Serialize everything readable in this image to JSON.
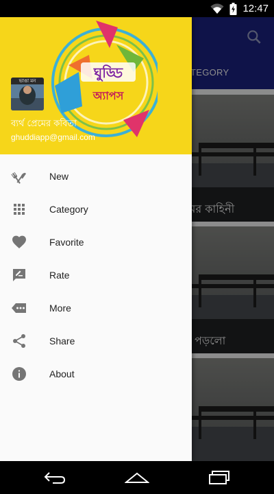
{
  "status_bar": {
    "time": "12:47"
  },
  "app_bar": {
    "tab_label": "ATEGORY"
  },
  "cards": [
    {
      "title": "মের কাহিনী"
    },
    {
      "title": "ম পড়লো"
    },
    {
      "title": ""
    }
  ],
  "drawer": {
    "logo_text_top": "ঘুড্ডি",
    "logo_text_bottom": "অ্যাপস",
    "avatar_label": "ভাঙা মন",
    "user_name": "ব্যর্থ প্রেমের কবিতা",
    "user_email": "ghuddiapp@gmail.com",
    "menu": [
      {
        "label": "New",
        "icon": "restaurant-icon"
      },
      {
        "label": "Category",
        "icon": "grid-icon"
      },
      {
        "label": "Favorite",
        "icon": "heart-icon"
      },
      {
        "label": "Rate",
        "icon": "rate-review-icon"
      },
      {
        "label": "More",
        "icon": "more-icon"
      },
      {
        "label": "Share",
        "icon": "share-icon"
      },
      {
        "label": "About",
        "icon": "info-icon"
      }
    ]
  },
  "colors": {
    "app_bar": "#1d2386",
    "drawer_header": "#f6d61a",
    "icon": "#757575"
  }
}
